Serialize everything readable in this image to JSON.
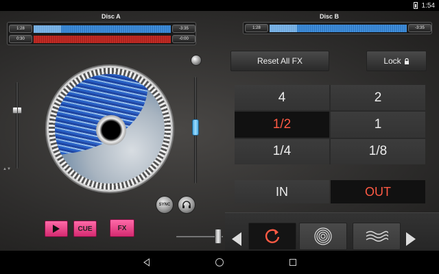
{
  "status": {
    "time": "1:54"
  },
  "deck_a": {
    "title": "Disc A",
    "time1_left": "1:28",
    "time1_right": "-3:35",
    "time2_left": "0:30",
    "time2_right": "-0:00",
    "progress_top": 0.2,
    "progress_bottom": 0.45,
    "play_label": "",
    "cue_label": "CUE",
    "fx_label": "FX",
    "sync_label": "SYNC"
  },
  "deck_b": {
    "title": "Disc B",
    "time_left": "1:28",
    "time_right": "-3:35",
    "progress": 0.2
  },
  "fx_panel": {
    "reset_label": "Reset All FX",
    "lock_label": "Lock",
    "beats": [
      {
        "label": "4",
        "active": false
      },
      {
        "label": "2",
        "active": false
      },
      {
        "label": "1/2",
        "active": true
      },
      {
        "label": "1",
        "active": false
      },
      {
        "label": "1/4",
        "active": false
      },
      {
        "label": "1/8",
        "active": false
      }
    ],
    "in_label": "IN",
    "out_label": "OUT"
  },
  "colors": {
    "accent": "#ff5a44",
    "pink": "#e8387f",
    "blue": "#3f8fe0"
  }
}
